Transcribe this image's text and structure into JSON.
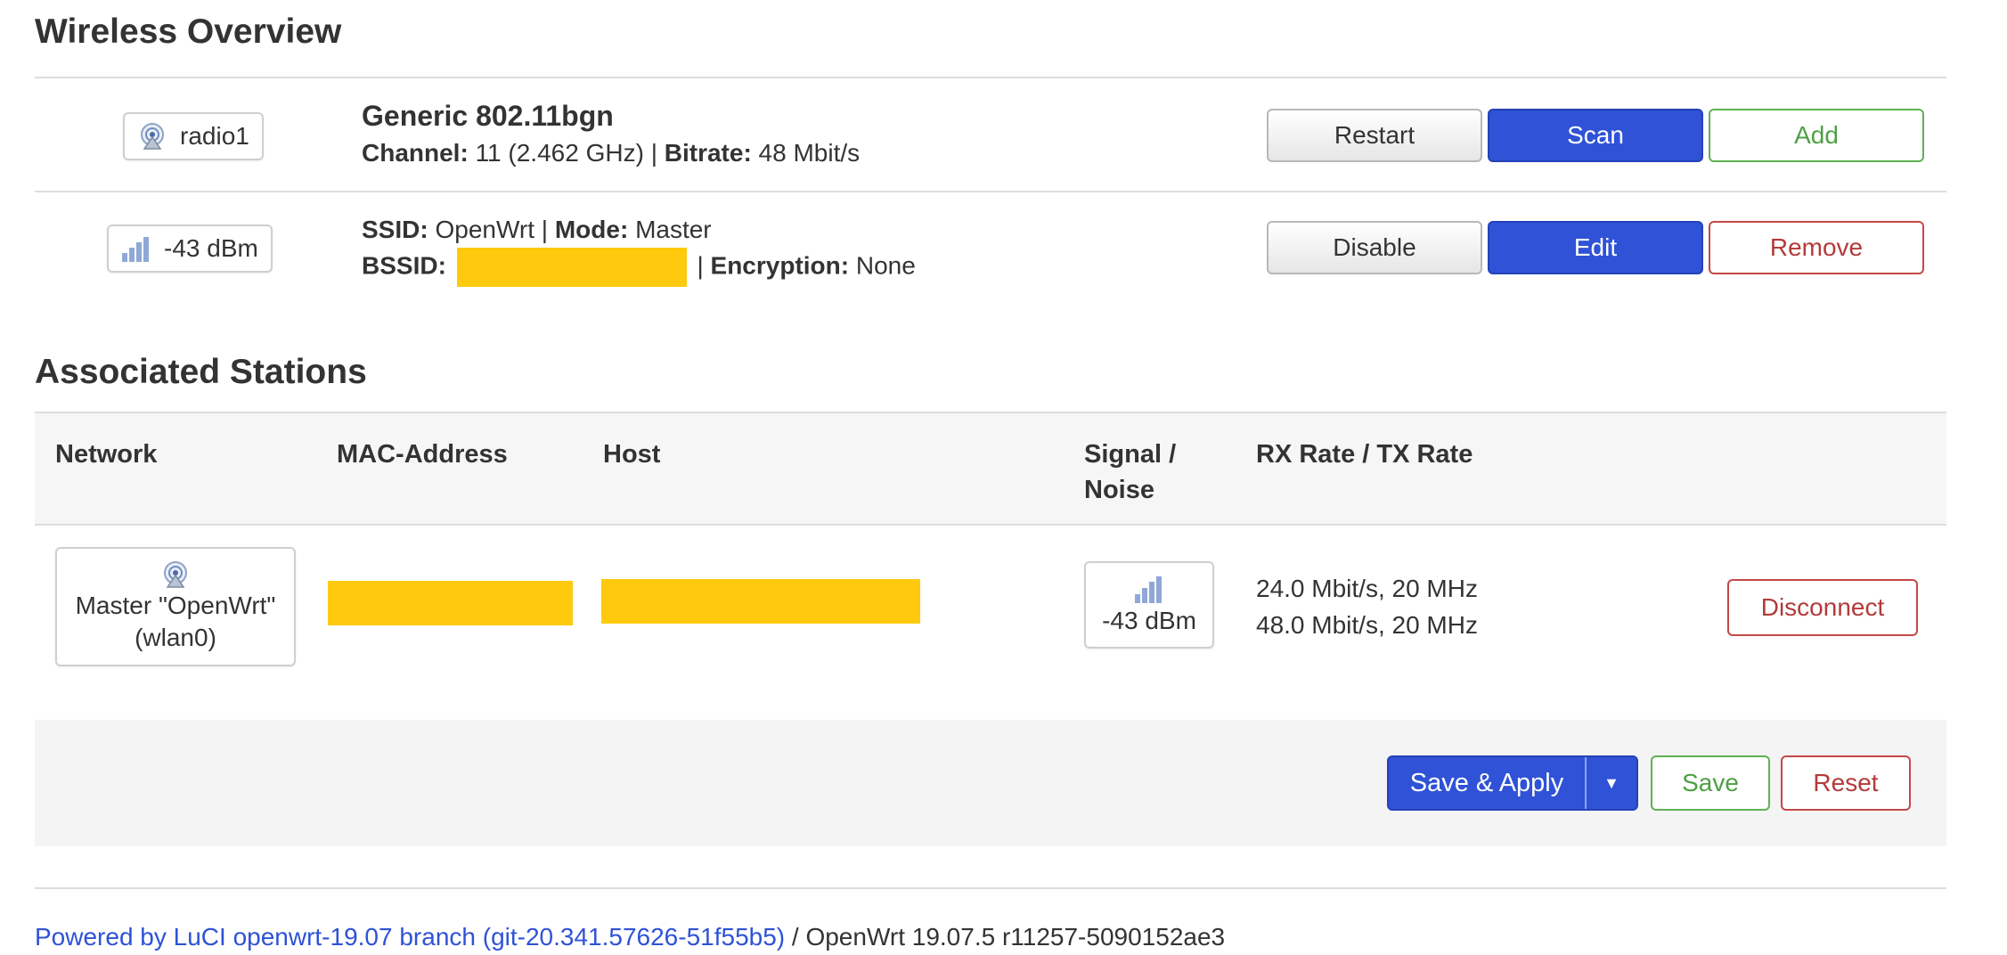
{
  "wireless": {
    "title": "Wireless Overview",
    "device": {
      "badge": "radio1",
      "name": "Generic 802.11bgn",
      "channel_label": "Channel:",
      "channel_value": "11 (2.462 GHz)",
      "sep": "|",
      "bitrate_label": "Bitrate:",
      "bitrate_value": "48 Mbit/s",
      "buttons": {
        "restart": "Restart",
        "scan": "Scan",
        "add": "Add"
      }
    },
    "network": {
      "badge": "-43 dBm",
      "ssid_label": "SSID:",
      "ssid_value": "OpenWrt",
      "mode_label": "Mode:",
      "mode_value": "Master",
      "bssid_label": "BSSID:",
      "encryption_label": "Encryption:",
      "encryption_value": "None",
      "sep": "|",
      "buttons": {
        "disable": "Disable",
        "edit": "Edit",
        "remove": "Remove"
      }
    }
  },
  "stations": {
    "title": "Associated Stations",
    "columns": {
      "network": "Network",
      "mac": "MAC-Address",
      "host": "Host",
      "signal_line1": "Signal /",
      "signal_line2": "Noise",
      "rate": "RX Rate / TX Rate"
    },
    "rows": [
      {
        "network_line1": "Master \"OpenWrt\"",
        "network_line2": "(wlan0)",
        "signal": "-43 dBm",
        "rx_rate": "24.0 Mbit/s, 20 MHz",
        "tx_rate": "48.0 Mbit/s, 20 MHz",
        "disconnect": "Disconnect"
      }
    ]
  },
  "actions": {
    "save_apply": "Save & Apply",
    "save": "Save",
    "reset": "Reset"
  },
  "footer": {
    "link_text": "Powered by LuCI openwrt-19.07 branch (git-20.341.57626-51f55b5)",
    "version": "/ OpenWrt 19.07.5 r11257-5090152ae3"
  },
  "colors": {
    "primary": "#2f52d6",
    "positive": "#4f9f45",
    "negative": "#b33a3a",
    "redaction": "#ffc90e"
  }
}
